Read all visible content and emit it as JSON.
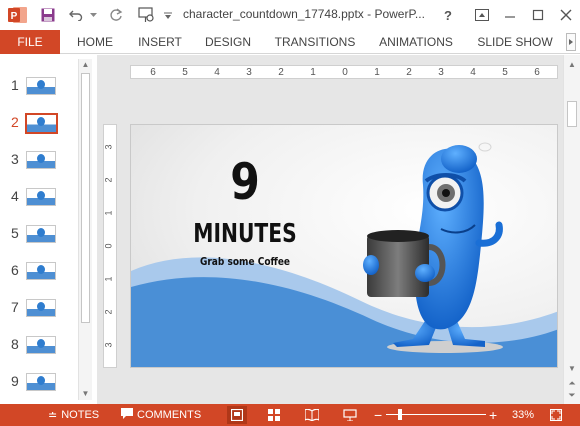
{
  "titlebar": {
    "document_title": "character_countdown_17748.pptx - PowerP...",
    "help_label": "?",
    "accent_color": "#d24726"
  },
  "ribbon": {
    "tabs": [
      {
        "label": "FILE"
      },
      {
        "label": "HOME"
      },
      {
        "label": "INSERT"
      },
      {
        "label": "DESIGN"
      },
      {
        "label": "TRANSITIONS"
      },
      {
        "label": "ANIMATIONS"
      },
      {
        "label": "SLIDE SHOW"
      }
    ]
  },
  "thumbnails": {
    "active_index": 2,
    "items": [
      {
        "number": "1"
      },
      {
        "number": "2"
      },
      {
        "number": "3"
      },
      {
        "number": "4"
      },
      {
        "number": "5"
      },
      {
        "number": "6"
      },
      {
        "number": "7"
      },
      {
        "number": "8"
      },
      {
        "number": "9"
      }
    ]
  },
  "ruler": {
    "horizontal_ticks": [
      "6",
      "5",
      "4",
      "3",
      "2",
      "1",
      "0",
      "1",
      "2",
      "3",
      "4",
      "5",
      "6"
    ],
    "vertical_ticks": [
      "3",
      "2",
      "1",
      "0",
      "1",
      "2",
      "3"
    ]
  },
  "slide": {
    "count": "9",
    "unit": "MINUTES",
    "subtitle": "Grab some Coffee",
    "wave_color": "#4a8fd6"
  },
  "statusbar": {
    "notes_label": "NOTES",
    "comments_label": "COMMENTS",
    "zoom_minus": "−",
    "zoom_plus": "+",
    "zoom_level": "33%",
    "zoom_fraction": 0.33
  }
}
